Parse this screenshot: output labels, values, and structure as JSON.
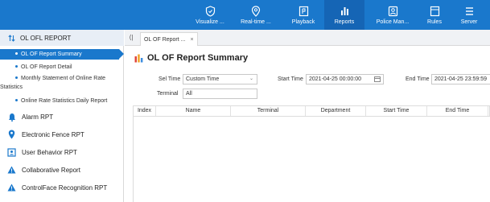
{
  "nav": {
    "items": [
      {
        "label": "Visualize ...",
        "icon": "shield-icon"
      },
      {
        "label": "Real-time ...",
        "icon": "map-pin-icon"
      },
      {
        "label": "Playback",
        "icon": "playback-icon"
      },
      {
        "label": "Reports",
        "icon": "bar-chart-icon",
        "active": true
      },
      {
        "label": "Police Man...",
        "icon": "police-badge-icon"
      },
      {
        "label": "Rules",
        "icon": "rules-icon"
      },
      {
        "label": "Server",
        "icon": "server-icon"
      }
    ]
  },
  "sidebar": {
    "header": "OL OFL REPORT",
    "subitems": [
      {
        "label": "OL OF Report Summary",
        "active": true
      },
      {
        "label": "OL OF Report Detail"
      },
      {
        "label": "Monthly Statement of Online Rate",
        "label_cont": "Statistics"
      },
      {
        "label": "Online Rate Statistics Daily Report"
      }
    ],
    "sections": [
      {
        "label": "Alarm RPT",
        "icon": "alarm-icon"
      },
      {
        "label": "Electronic Fence RPT",
        "icon": "location-pin-icon"
      },
      {
        "label": "User Behavior RPT",
        "icon": "user-behavior-icon"
      },
      {
        "label": "Collaborative Report",
        "icon": "warning-icon"
      },
      {
        "label": "ControlFace Recognition RPT",
        "icon": "warning-icon"
      }
    ]
  },
  "tabs": {
    "collapse_label": "⟨|",
    "items": [
      {
        "label": "OL OF Report ...",
        "close": "×"
      }
    ]
  },
  "page": {
    "title": "OL OF Report Summary",
    "sel_time_label": "Sel Time",
    "sel_time_value": "Custom Time",
    "start_time_label": "Start Time",
    "start_time_value": "2021-04-25 00:00:00",
    "end_time_label": "End Time",
    "end_time_value": "2021-04-25 23:59:59",
    "terminal_label": "Terminal",
    "terminal_value": "All"
  },
  "table": {
    "columns": [
      "Index",
      "Name",
      "Terminal",
      "Department",
      "Start Time",
      "End Time"
    ]
  },
  "colors": {
    "accent": "#1a78cc",
    "accent_dark": "#1565b5",
    "sidebar_header_bg": "#e8eef6",
    "warning": "#1a78cc"
  }
}
